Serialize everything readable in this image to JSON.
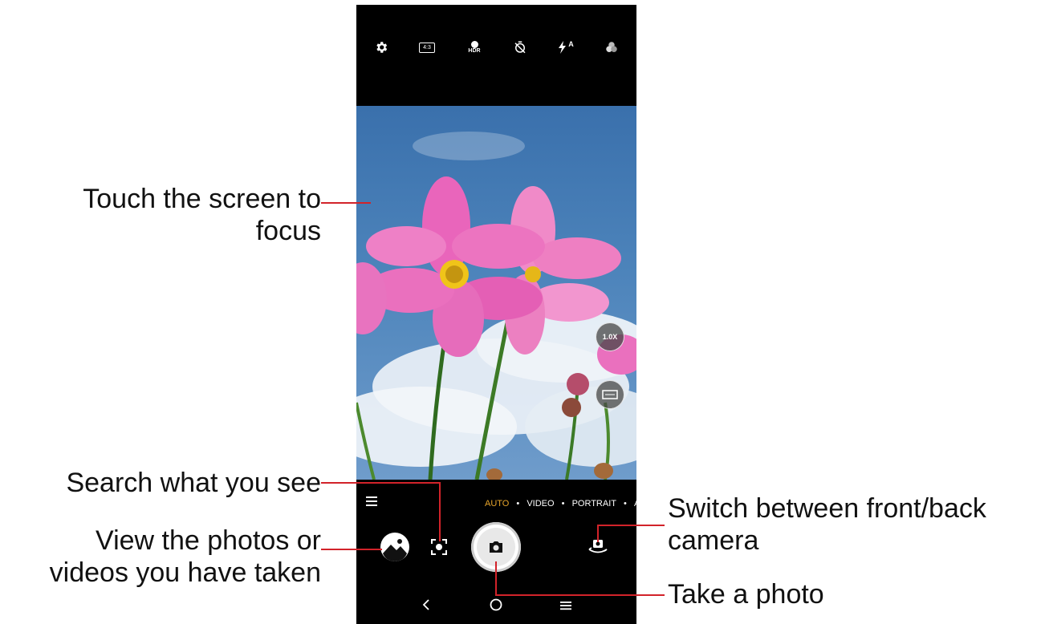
{
  "top_bar": {
    "icons": [
      "gear-icon",
      "aspect-ratio-icon",
      "hdr-icon",
      "timer-off-icon",
      "flash-auto-icon",
      "filters-icon"
    ],
    "aspect_label": "4:3",
    "hdr_label": "HDR",
    "flash_label": "A"
  },
  "viewfinder": {
    "zoom_label": "1.0X"
  },
  "modes": {
    "items": [
      "AUTO",
      "VIDEO",
      "PORTRAIT",
      "AI"
    ],
    "active": "AUTO",
    "separator": "•"
  },
  "callouts": {
    "focus_line1": "Touch the screen to",
    "focus_line2": "focus",
    "search": "Search what you see",
    "gallery_line1": "View the photos or",
    "gallery_line2": "videos you have taken",
    "switch_line1": "Switch between front/back",
    "switch_line2": "camera",
    "take_photo": "Take a photo"
  },
  "colors": {
    "callout_line": "#d2232a",
    "active_mode": "#e7a52b"
  }
}
